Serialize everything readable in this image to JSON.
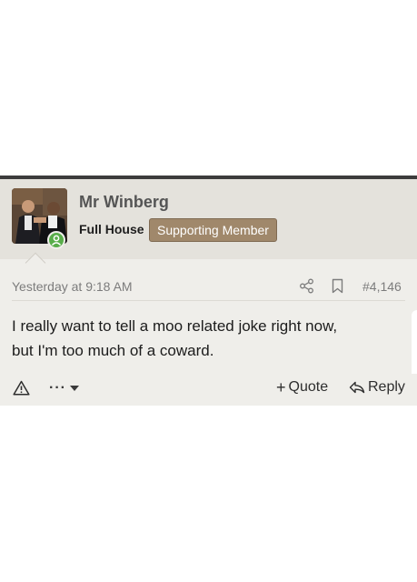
{
  "post": {
    "username": "Mr Winberg",
    "user_title": "Full House",
    "badge": "Supporting Member",
    "date": "Yesterday at 9:18 AM",
    "post_number": "#4,146",
    "message_lines": [
      "I really want to tell a moo related joke right now,",
      "but I'm too much of a coward."
    ]
  },
  "actions": {
    "more_label": "···",
    "quote_label": "Quote",
    "reply_label": "Reply"
  },
  "icons": {
    "avatar": "user-avatar",
    "online": "online-indicator-icon",
    "share": "share-icon",
    "bookmark": "bookmark-icon",
    "report": "warning-icon",
    "more": "chevron-down-icon",
    "quote": "plus-icon",
    "reply": "reply-icon"
  },
  "colors": {
    "header_bg": "#e4e2dc",
    "post_bg": "#efeeea",
    "badge_bg": "#a0886b",
    "online": "#58ad4a"
  }
}
